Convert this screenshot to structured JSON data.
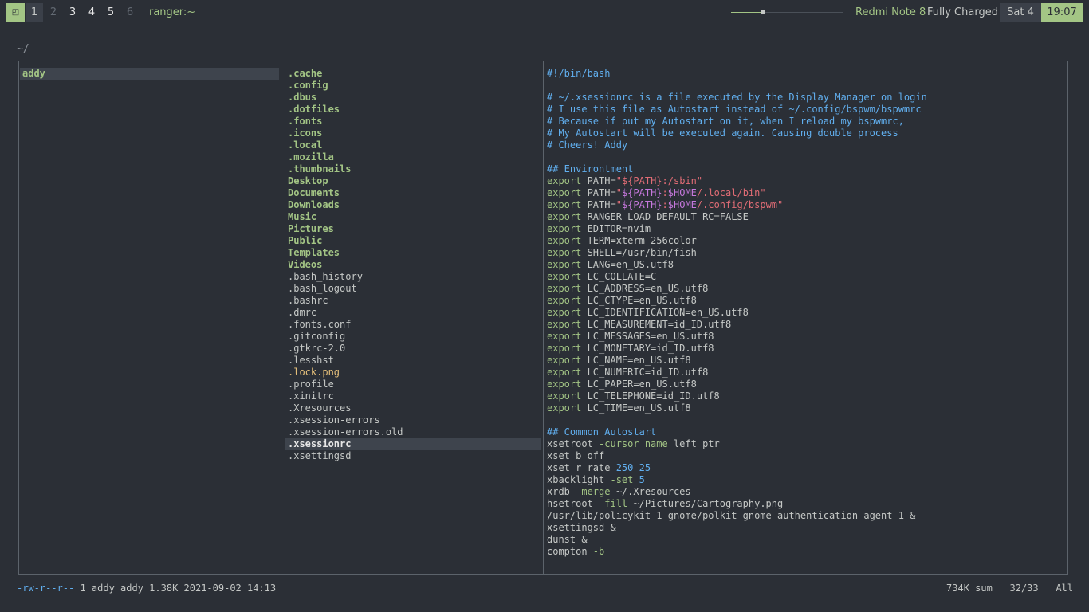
{
  "topbar": {
    "layout_icon": "◰",
    "workspaces": [
      {
        "label": "1",
        "state": "active"
      },
      {
        "label": "2",
        "state": "empty"
      },
      {
        "label": "3",
        "state": "occupied"
      },
      {
        "label": "4",
        "state": "occupied"
      },
      {
        "label": "5",
        "state": "occupied"
      },
      {
        "label": "6",
        "state": "empty"
      }
    ],
    "window_title": "ranger:~",
    "volume_level": 0.28,
    "device": "Redmi Note 8",
    "battery": "Fully Charged",
    "date": "Sat 4",
    "time": "19:07"
  },
  "ranger": {
    "cwd": "~/",
    "parent": [
      {
        "name": "addy",
        "type": "dir",
        "selected": true
      }
    ],
    "files": [
      {
        "name": ".cache",
        "type": "dir"
      },
      {
        "name": ".config",
        "type": "dir"
      },
      {
        "name": ".dbus",
        "type": "dir"
      },
      {
        "name": ".dotfiles",
        "type": "dir"
      },
      {
        "name": ".fonts",
        "type": "dir"
      },
      {
        "name": ".icons",
        "type": "dir"
      },
      {
        "name": ".local",
        "type": "dir"
      },
      {
        "name": ".mozilla",
        "type": "dir"
      },
      {
        "name": ".thumbnails",
        "type": "dir"
      },
      {
        "name": "Desktop",
        "type": "dir"
      },
      {
        "name": "Documents",
        "type": "dir"
      },
      {
        "name": "Downloads",
        "type": "dir"
      },
      {
        "name": "Music",
        "type": "dir"
      },
      {
        "name": "Pictures",
        "type": "dir"
      },
      {
        "name": "Public",
        "type": "dir"
      },
      {
        "name": "Templates",
        "type": "dir"
      },
      {
        "name": "Videos",
        "type": "dir"
      },
      {
        "name": ".bash_history",
        "type": "file"
      },
      {
        "name": ".bash_logout",
        "type": "file"
      },
      {
        "name": ".bashrc",
        "type": "file"
      },
      {
        "name": ".dmrc",
        "type": "file"
      },
      {
        "name": ".fonts.conf",
        "type": "file"
      },
      {
        "name": ".gitconfig",
        "type": "file"
      },
      {
        "name": ".gtkrc-2.0",
        "type": "file"
      },
      {
        "name": ".lesshst",
        "type": "file"
      },
      {
        "name": ".lock.png",
        "type": "img"
      },
      {
        "name": ".profile",
        "type": "file"
      },
      {
        "name": ".xinitrc",
        "type": "file"
      },
      {
        "name": ".Xresources",
        "type": "file"
      },
      {
        "name": ".xsession-errors",
        "type": "file"
      },
      {
        "name": ".xsession-errors.old",
        "type": "file"
      },
      {
        "name": ".xsessionrc",
        "type": "file",
        "selected": true
      },
      {
        "name": ".xsettingsd",
        "type": "file"
      }
    ],
    "preview_lines": [
      [
        {
          "t": "#!/bin/bash",
          "k": "c"
        }
      ],
      [],
      [
        {
          "t": "# ~/.xsessionrc is a file executed by the Display Manager on login",
          "k": "c"
        }
      ],
      [
        {
          "t": "# I use this file as Autostart instead of ~/.config/bspwm/bspwmrc",
          "k": "c"
        }
      ],
      [
        {
          "t": "# Because if put my Autostart on it, when I reload my bspwmrc,",
          "k": "c"
        }
      ],
      [
        {
          "t": "# My Autostart will be executed again. Causing double process",
          "k": "c"
        }
      ],
      [
        {
          "t": "# Cheers! Addy",
          "k": "c"
        }
      ],
      [],
      [
        {
          "t": "## Environtment",
          "k": "c"
        }
      ],
      [
        {
          "t": "export",
          "k": "kw"
        },
        {
          "t": " PATH=",
          "k": ""
        },
        {
          "t": "\"${PATH}:/sbin\"",
          "k": "str"
        }
      ],
      [
        {
          "t": "export",
          "k": "kw"
        },
        {
          "t": " PATH=",
          "k": ""
        },
        {
          "t": "\"",
          "k": "str"
        },
        {
          "t": "${PATH}",
          "k": "var"
        },
        {
          "t": ":",
          "k": "str"
        },
        {
          "t": "$HOME",
          "k": "var"
        },
        {
          "t": "/.local/bin\"",
          "k": "str"
        }
      ],
      [
        {
          "t": "export",
          "k": "kw"
        },
        {
          "t": " PATH=",
          "k": ""
        },
        {
          "t": "\"",
          "k": "str"
        },
        {
          "t": "${PATH}",
          "k": "var"
        },
        {
          "t": ":",
          "k": "str"
        },
        {
          "t": "$HOME",
          "k": "var"
        },
        {
          "t": "/.config/bspwm\"",
          "k": "str"
        }
      ],
      [
        {
          "t": "export",
          "k": "kw"
        },
        {
          "t": " RANGER_LOAD_DEFAULT_RC=FALSE",
          "k": ""
        }
      ],
      [
        {
          "t": "export",
          "k": "kw"
        },
        {
          "t": " EDITOR=nvim",
          "k": ""
        }
      ],
      [
        {
          "t": "export",
          "k": "kw"
        },
        {
          "t": " TERM=xterm-256color",
          "k": ""
        }
      ],
      [
        {
          "t": "export",
          "k": "kw"
        },
        {
          "t": " SHELL=/usr/bin/fish",
          "k": ""
        }
      ],
      [
        {
          "t": "export",
          "k": "kw"
        },
        {
          "t": " LANG=en_US.utf8",
          "k": ""
        }
      ],
      [
        {
          "t": "export",
          "k": "kw"
        },
        {
          "t": " LC_COLLATE=C",
          "k": ""
        }
      ],
      [
        {
          "t": "export",
          "k": "kw"
        },
        {
          "t": " LC_ADDRESS=en_US.utf8",
          "k": ""
        }
      ],
      [
        {
          "t": "export",
          "k": "kw"
        },
        {
          "t": " LC_CTYPE=en_US.utf8",
          "k": ""
        }
      ],
      [
        {
          "t": "export",
          "k": "kw"
        },
        {
          "t": " LC_IDENTIFICATION=en_US.utf8",
          "k": ""
        }
      ],
      [
        {
          "t": "export",
          "k": "kw"
        },
        {
          "t": " LC_MEASUREMENT=id_ID.utf8",
          "k": ""
        }
      ],
      [
        {
          "t": "export",
          "k": "kw"
        },
        {
          "t": " LC_MESSAGES=en_US.utf8",
          "k": ""
        }
      ],
      [
        {
          "t": "export",
          "k": "kw"
        },
        {
          "t": " LC_MONETARY=id_ID.utf8",
          "k": ""
        }
      ],
      [
        {
          "t": "export",
          "k": "kw"
        },
        {
          "t": " LC_NAME=en_US.utf8",
          "k": ""
        }
      ],
      [
        {
          "t": "export",
          "k": "kw"
        },
        {
          "t": " LC_NUMERIC=id_ID.utf8",
          "k": ""
        }
      ],
      [
        {
          "t": "export",
          "k": "kw"
        },
        {
          "t": " LC_PAPER=en_US.utf8",
          "k": ""
        }
      ],
      [
        {
          "t": "export",
          "k": "kw"
        },
        {
          "t": " LC_TELEPHONE=id_ID.utf8",
          "k": ""
        }
      ],
      [
        {
          "t": "export",
          "k": "kw"
        },
        {
          "t": " LC_TIME=en_US.utf8",
          "k": ""
        }
      ],
      [],
      [
        {
          "t": "## Common Autostart",
          "k": "c"
        }
      ],
      [
        {
          "t": "xsetroot ",
          "k": ""
        },
        {
          "t": "-cursor_name",
          "k": "flag"
        },
        {
          "t": " left_ptr",
          "k": ""
        }
      ],
      [
        {
          "t": "xset b off",
          "k": ""
        }
      ],
      [
        {
          "t": "xset r rate ",
          "k": ""
        },
        {
          "t": "250",
          "k": "num"
        },
        {
          "t": " ",
          "k": ""
        },
        {
          "t": "25",
          "k": "num"
        }
      ],
      [
        {
          "t": "xbacklight ",
          "k": ""
        },
        {
          "t": "-set",
          "k": "flag"
        },
        {
          "t": " ",
          "k": ""
        },
        {
          "t": "5",
          "k": "num"
        }
      ],
      [
        {
          "t": "xrdb ",
          "k": ""
        },
        {
          "t": "-merge",
          "k": "flag"
        },
        {
          "t": " ~/.Xresources",
          "k": ""
        }
      ],
      [
        {
          "t": "hsetroot ",
          "k": ""
        },
        {
          "t": "-fill",
          "k": "flag"
        },
        {
          "t": " ~/Pictures/Cartography.png",
          "k": ""
        }
      ],
      [
        {
          "t": "/usr/lib/policykit-1-gnome/polkit-gnome-authentication-agent-1 &",
          "k": ""
        }
      ],
      [
        {
          "t": "xsettingsd &",
          "k": ""
        }
      ],
      [
        {
          "t": "dunst &",
          "k": ""
        }
      ],
      [
        {
          "t": "compton ",
          "k": ""
        },
        {
          "t": "-b",
          "k": "flag"
        }
      ]
    ],
    "status": {
      "permissions": "-rw-r--r--",
      "meta": "1 addy addy 1.38K 2021-09-02 14:13",
      "summary": "734K sum",
      "position": "32/33",
      "scroll": "All"
    }
  }
}
